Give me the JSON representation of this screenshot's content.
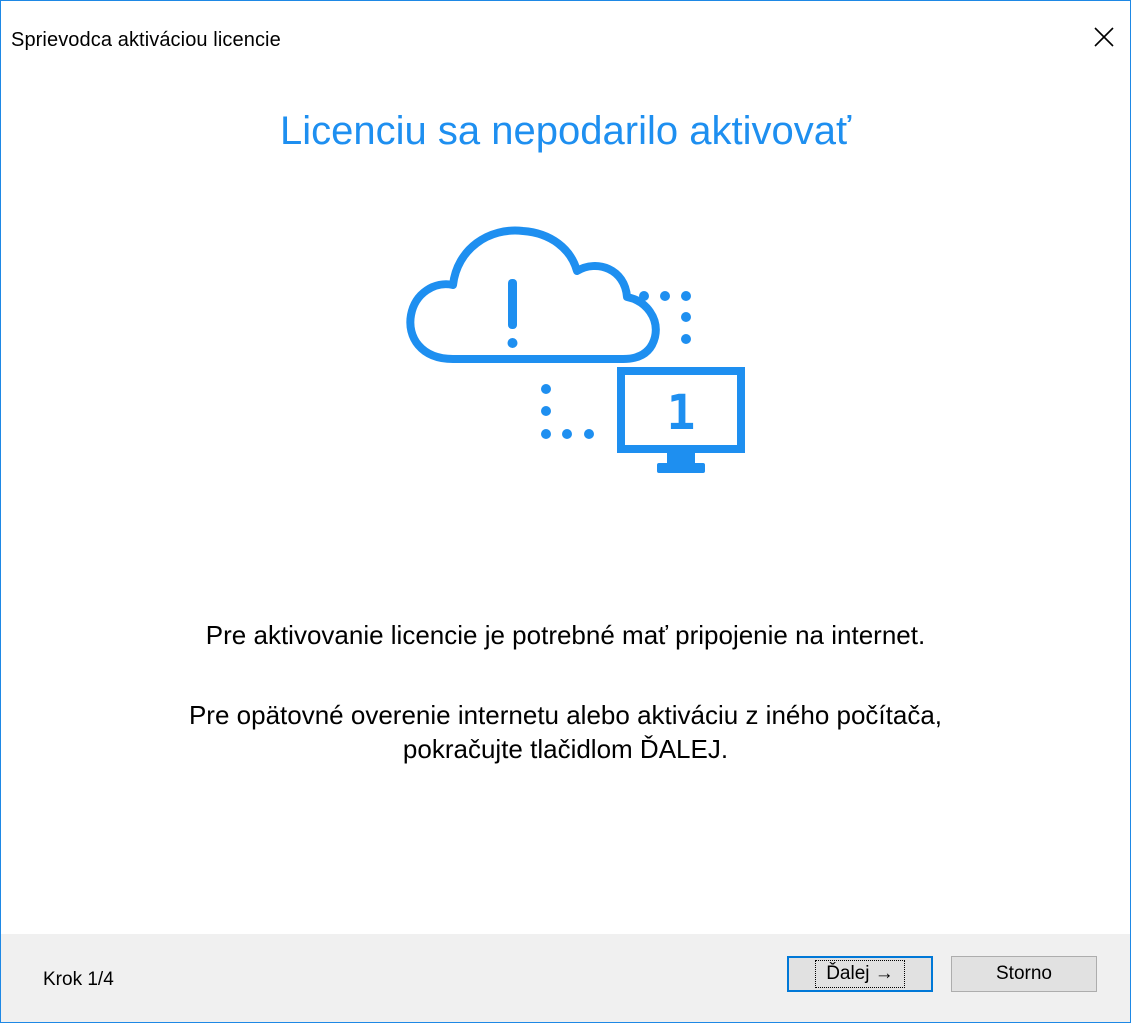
{
  "window": {
    "title": "Sprievodca aktiváciou licencie"
  },
  "main": {
    "headline": "Licenciu sa nepodarilo aktivovať",
    "illustration": {
      "cloud_symbol": "!",
      "monitor_number": "1",
      "icons": [
        "cloud-warning-icon",
        "monitor-icon",
        "dotted-connector-icon"
      ]
    },
    "message_line1": "Pre aktivovanie licencie je potrebné mať pripojenie na internet.",
    "message_line2": "Pre opätovné overenie internetu alebo aktiváciu z iného počítača,",
    "message_line3": "pokračujte tlačidlom ĎALEJ."
  },
  "footer": {
    "step_label": "Krok 1/4",
    "next_label": "Ďalej →",
    "cancel_label": "Storno"
  },
  "colors": {
    "accent": "#1e8ff0",
    "window_border": "#1e88e5",
    "footer_bg": "#f0f0f0",
    "focus_border": "#0078d7"
  }
}
